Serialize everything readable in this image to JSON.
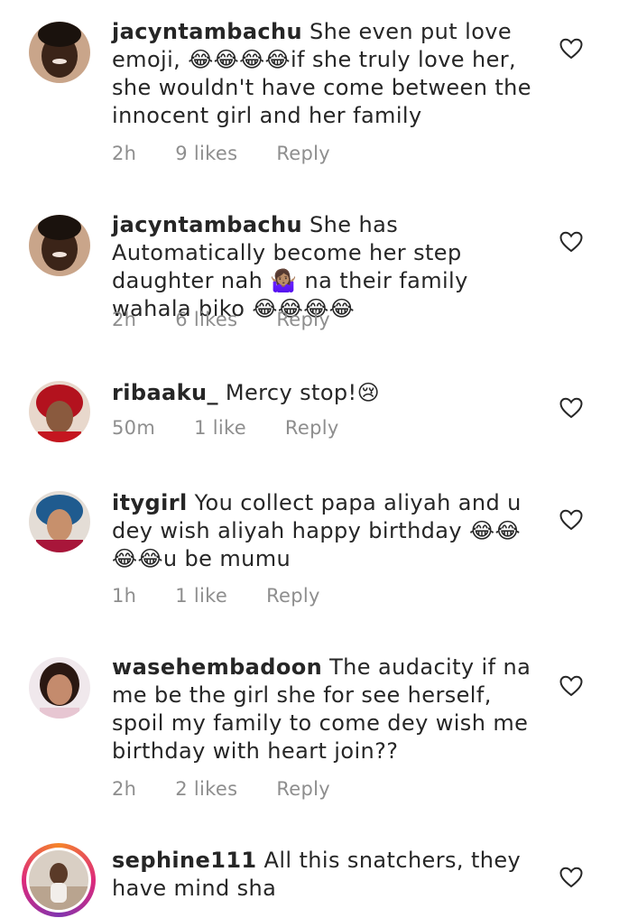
{
  "comments": [
    {
      "username": "jacyntambachu",
      "text": "She even put love emoji, 😂😂😂😂if she truly love her, she wouldn't have come between the innocent girl and her family",
      "time": "2h",
      "likes": "9 likes",
      "reply": "Reply"
    },
    {
      "username": "jacyntambachu",
      "text": "She has Automatically become her step daughter nah 🤷🏽‍♀️ na their family wahala biko 😂😂😂😂",
      "time": "2h",
      "likes": "6 likes",
      "reply": "Reply"
    },
    {
      "username": "ribaaku_",
      "text": "Mercy stop!😢",
      "time": "50m",
      "likes": "1 like",
      "reply": "Reply"
    },
    {
      "username": "itygirl",
      "text": "You collect papa aliyah and u dey wish aliyah happy birthday 😂😂😂😂u be mumu",
      "time": "1h",
      "likes": "1 like",
      "reply": "Reply"
    },
    {
      "username": "wasehembadoon",
      "text": "The audacity if na me be the girl she for see herself, spoil my family to come dey wish me birthday with heart join??",
      "time": "2h",
      "likes": "2 likes",
      "reply": "Reply"
    },
    {
      "username": "sephine111",
      "text": "All this snatchers, they have mind sha",
      "time": "",
      "likes": "",
      "reply": ""
    }
  ],
  "icons": {
    "heart": "heart-outline-icon"
  },
  "colors": {
    "text": "#262626",
    "meta": "#8e8e8e",
    "story_ring": "#dd2a7b"
  }
}
